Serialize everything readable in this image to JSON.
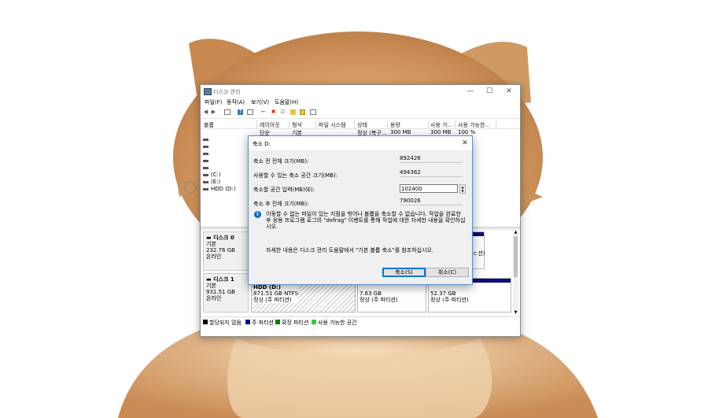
{
  "window": {
    "title": "디스크 관리",
    "menu": [
      "파일(F)",
      "동작(A)",
      "보기(V)",
      "도움말(H)"
    ],
    "controls": {
      "minimize": "—",
      "maximize": "☐",
      "close": "✕"
    }
  },
  "volume_list": {
    "columns": [
      "볼륨",
      "레이아웃",
      "형식",
      "파일 시스템",
      "상태",
      "용량",
      "사용 가...",
      "사용 가능한..."
    ],
    "rows": [
      {
        "volume": "",
        "layout": "단순",
        "type": "기본",
        "fs": "",
        "status": "정상 (복구...",
        "capacity": "300 MB",
        "free": "300 MB",
        "pct": "100 %"
      },
      {
        "volume": "",
        "layout": "",
        "type": "",
        "fs": "",
        "status": "",
        "capacity": "",
        "free": "",
        "pct": ""
      },
      {
        "volume": "",
        "layout": "",
        "type": "",
        "fs": "",
        "status": "",
        "capacity": "",
        "free": "",
        "pct": ""
      },
      {
        "volume": "",
        "layout": "",
        "type": "",
        "fs": "",
        "status": "",
        "capacity": "",
        "free": "",
        "pct": ""
      },
      {
        "volume": "",
        "layout": "",
        "type": "",
        "fs": "",
        "status": "",
        "capacity": "",
        "free": "",
        "pct": ""
      },
      {
        "volume": "",
        "layout": "",
        "type": "",
        "fs": "",
        "status": "",
        "capacity": "",
        "free": "",
        "pct": ""
      },
      {
        "volume": "(C:)",
        "layout": "",
        "type": "",
        "fs": "",
        "status": "",
        "capacity": "",
        "free": "",
        "pct": ""
      },
      {
        "volume": "(E:)",
        "layout": "",
        "type": "",
        "fs": "",
        "status": "",
        "capacity": "",
        "free": "",
        "pct": ""
      },
      {
        "volume": "HDD (D:)",
        "layout": "",
        "type": "",
        "fs": "",
        "status": "",
        "capacity": "",
        "free": "",
        "pct": ""
      }
    ]
  },
  "disks": [
    {
      "name": "디스크 0",
      "type": "기본",
      "size": "232.76 GB",
      "state": "온라인",
      "partial": "ㄷ션)"
    },
    {
      "name": "디스크 1",
      "type": "기본",
      "size": "931.51 GB",
      "state": "온라인",
      "partitions": [
        {
          "title": "HDD (D:)",
          "size": "871.51 GB NTFS",
          "status": "정상 (주 파티션)"
        },
        {
          "title": "",
          "size": "7.63 GB",
          "status": "정상 (주 파티션)"
        },
        {
          "title": "",
          "size": "52.37 GB",
          "status": "정상 (주 파티션)"
        }
      ]
    }
  ],
  "legend": [
    {
      "label": "할당되지 않음",
      "color": "#000000"
    },
    {
      "label": "주 파티션",
      "color": "#0d0d7a"
    },
    {
      "label": "확장 파티션",
      "color": "#007d00"
    },
    {
      "label": "사용 가능한 공간",
      "color": "#33cc33"
    }
  ],
  "dialog": {
    "title": "축소 D:",
    "close": "✕",
    "total_before_label": "축소 전 전체 크기(MB):",
    "total_before_value": "892426",
    "available_label": "사용할 수 있는 축소 공간 크기(MB):",
    "available_value": "494362",
    "input_label": "축소할 공간 입력(MB)(E):",
    "input_value": "102400",
    "total_after_label": "축소 후 전체 크기(MB):",
    "total_after_value": "790026",
    "info_text": "이동할 수 없는 파일이 있는 지점을 벗어나 볼륨을 축소할 수 없습니다. 작업을 완료한 후 응용 프로그램 로그의 \"defrag\" 이벤트를 통해 작업에 대한 자세한 내용을 확인하십시오.",
    "note_text": "자세한 내용은 디스크 관리 도움말에서 \"기본 볼륨 축소\"를 참조하십시오.",
    "ok_label": "축소(S)",
    "cancel_label": "취소(C)"
  }
}
